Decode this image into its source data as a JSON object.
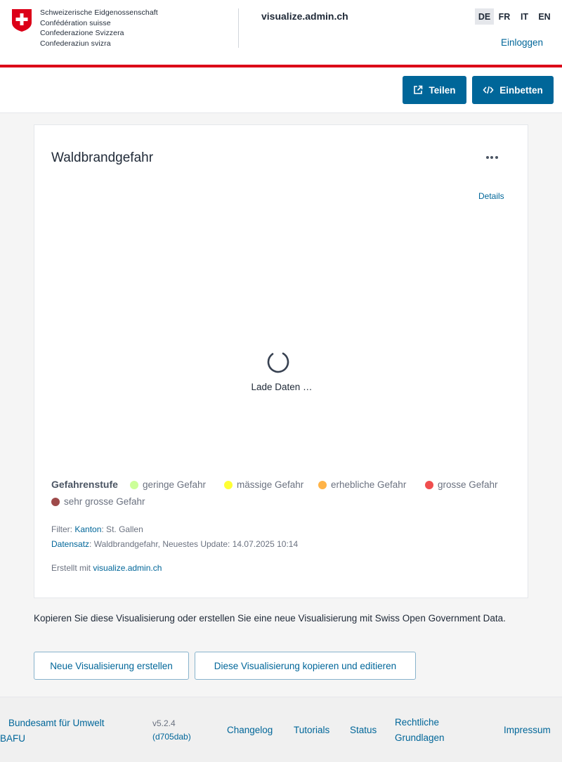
{
  "header": {
    "confederation": [
      "Schweizerische Eidgenossenschaft",
      "Confédération suisse",
      "Confederazione Svizzera",
      "Confederaziun svizra"
    ],
    "site_title": "visualize.admin.ch",
    "languages": [
      "DE",
      "FR",
      "IT",
      "EN"
    ],
    "active_language": "DE",
    "login": "Einloggen",
    "accent_color": "#dc0018"
  },
  "toolbar": {
    "share_label": "Teilen",
    "embed_label": "Einbetten",
    "primary_color": "#006699"
  },
  "chart": {
    "title": "Waldbrandgefahr",
    "details_label": "Details",
    "loading_text": "Lade Daten …",
    "legend": {
      "title": "Gefahrenstufe",
      "items": [
        {
          "label": "geringe Gefahr",
          "color": "#ccff99"
        },
        {
          "label": "mässige Gefahr",
          "color": "#ffff33"
        },
        {
          "label": "erhebliche Gefahr",
          "color": "#ffb347"
        },
        {
          "label": "grosse Gefahr",
          "color": "#f04e4e"
        },
        {
          "label": "sehr grosse Gefahr",
          "color": "#9e4a4a"
        }
      ]
    },
    "filter_label": "Filter:",
    "filter_key": "Kanton",
    "filter_value": ": St. Gallen",
    "dataset_key": "Datensatz",
    "dataset_value": ": Waldbrandgefahr, Neuestes Update: 14.07.2025 10:14",
    "created_with_label": "Erstellt mit",
    "created_with_link": "visualize.admin.ch"
  },
  "cta": {
    "text": "Kopieren Sie diese Visualisierung oder erstellen Sie eine neue Visualisierung mit Swiss Open Government Data.",
    "new_button": "Neue Visualisierung erstellen",
    "copy_button": "Diese Visualisierung kopieren und editieren"
  },
  "footer": {
    "org_line1": "Bundesamt für Umwelt",
    "org_line2": "BAFU",
    "version": "v5.2.4",
    "commit": "(d705dab)",
    "changelog": "Changelog",
    "tutorials": "Tutorials",
    "status": "Status",
    "legal_line1": "Rechtliche",
    "legal_line2": "Grundlagen",
    "imprint": "Impressum"
  }
}
